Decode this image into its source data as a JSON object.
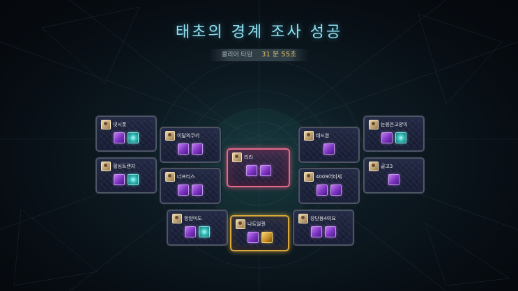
{
  "header": {
    "title": "태초의 경계 조사 성공",
    "clear_time_label": "클리어 타임",
    "clear_time_value": "31 분 55초"
  },
  "party": [
    {
      "name": "넷시롯",
      "items": [
        "purple",
        "teal"
      ]
    },
    {
      "name": "혈심트랜지",
      "items": [
        "purple",
        "teal"
      ]
    },
    {
      "name": "이달의쿠키",
      "items": [
        "purple",
        "purple"
      ]
    },
    {
      "name": "너프티스",
      "items": [
        "purple",
        "purple"
      ]
    },
    {
      "name": "항암미도",
      "items": [
        "purple",
        "teal"
      ]
    },
    {
      "name": "리라",
      "items": [
        "purple",
        "purple"
      ]
    },
    {
      "name": "나트일렌",
      "items": [
        "purple",
        "gold"
      ]
    },
    {
      "name": "태드완",
      "items": [
        "purple"
      ]
    },
    {
      "name": "4009어비세",
      "items": [
        "purple",
        "purple"
      ]
    },
    {
      "name": "눈뭉은고양이",
      "items": [
        "purple",
        "teal"
      ]
    },
    {
      "name": "골고3",
      "items": [
        "purple"
      ]
    },
    {
      "name": "장단용4여요",
      "items": [
        "purple",
        "purple"
      ]
    }
  ],
  "colors": {
    "title": "#8fe1f0",
    "time_value": "#e8c76a",
    "highlight_pink": "#e36a8a",
    "highlight_gold": "#d9a83b"
  }
}
